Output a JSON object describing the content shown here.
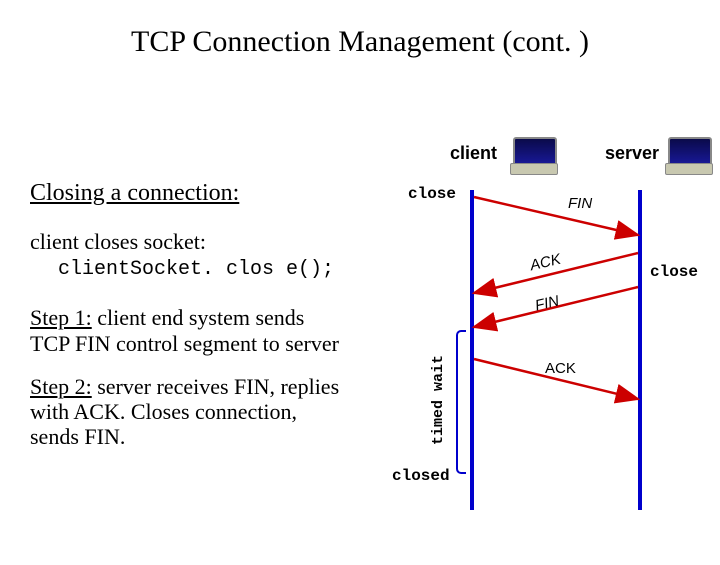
{
  "title": "TCP Connection Management (cont. )",
  "left": {
    "heading": "Closing a connection:",
    "socket_intro": "client closes socket:",
    "socket_code": "clientSocket. clos e();",
    "step1_label": "Step 1:",
    "step1_text": " client end system sends TCP FIN control segment to server",
    "step2_label": "Step 2:",
    "step2_text": " server receives FIN, replies with ACK. Closes connection, sends FIN."
  },
  "diagram": {
    "client_label": "client",
    "server_label": "server",
    "close_left": "close",
    "close_right": "close",
    "closed": "closed",
    "timed_wait": "timed wait",
    "msg_fin1": "FIN",
    "msg_ack1": "ACK",
    "msg_fin2": "FIN",
    "msg_ack2": "ACK"
  }
}
